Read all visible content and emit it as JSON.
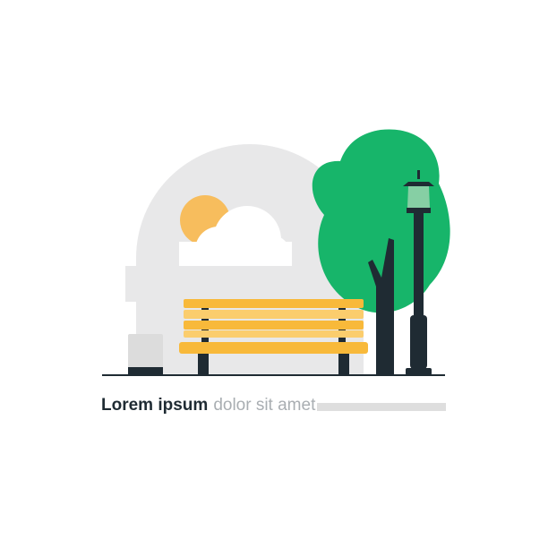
{
  "caption": {
    "primary": "Lorem ipsum",
    "secondary": "dolor sit amet"
  },
  "colors": {
    "arch": "#e8e8e9",
    "sun": "#f7bd5d",
    "cloud": "#ffffff",
    "bench": "#f8b93a",
    "bench_light": "#fbcd6d",
    "dark": "#1f2b33",
    "tree": "#17b56a",
    "lamp_glass": "#86cfa4",
    "bin": "#dcdcdc",
    "caption_line": "#dedede"
  },
  "icons": [
    "sun-icon",
    "cloud-icon",
    "bench-icon",
    "tree-icon",
    "street-lamp-icon",
    "trash-bin-icon"
  ]
}
